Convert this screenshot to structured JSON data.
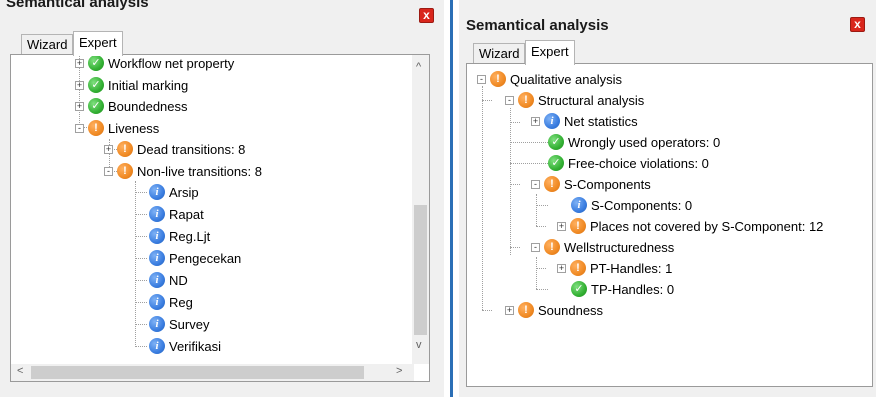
{
  "left": {
    "title": "Semantical analysis",
    "close_glyph": "x",
    "tabs": [
      {
        "label": "Wizard",
        "active": false
      },
      {
        "label": "Expert",
        "active": true
      }
    ],
    "nodes": [
      {
        "label": "Workflow net property",
        "status": "ok",
        "expander": "+"
      },
      {
        "label": "Initial marking",
        "status": "ok",
        "expander": "+"
      },
      {
        "label": "Boundedness",
        "status": "ok",
        "expander": "+"
      },
      {
        "label": "Liveness",
        "status": "warn",
        "expander": "-"
      },
      {
        "label": "Dead transitions: 8",
        "status": "warn",
        "expander": "+"
      },
      {
        "label": "Non-live transitions: 8",
        "status": "warn",
        "expander": "-"
      },
      {
        "label": "Arsip",
        "status": "info"
      },
      {
        "label": "Rapat",
        "status": "info"
      },
      {
        "label": "Reg.Ljt",
        "status": "info"
      },
      {
        "label": "Pengecekan",
        "status": "info"
      },
      {
        "label": "ND",
        "status": "info"
      },
      {
        "label": "Reg",
        "status": "info"
      },
      {
        "label": "Survey",
        "status": "info"
      },
      {
        "label": "Verifikasi",
        "status": "info"
      }
    ],
    "scroll_arrows": {
      "up": "^",
      "down": "v",
      "left": "<",
      "right": ">"
    }
  },
  "right": {
    "title": "Semantical analysis",
    "close_glyph": "x",
    "tabs": [
      {
        "label": "Wizard",
        "active": false
      },
      {
        "label": "Expert",
        "active": true
      }
    ],
    "nodes": [
      {
        "label": "Qualitative analysis",
        "status": "warn",
        "expander": "-"
      },
      {
        "label": "Structural analysis",
        "status": "warn",
        "expander": "-"
      },
      {
        "label": "Net statistics",
        "status": "info",
        "expander": "+"
      },
      {
        "label": "Wrongly used operators: 0",
        "status": "ok"
      },
      {
        "label": "Free-choice violations: 0",
        "status": "ok"
      },
      {
        "label": "S-Components",
        "status": "warn",
        "expander": "-"
      },
      {
        "label": "S-Components: 0",
        "status": "info"
      },
      {
        "label": "Places not covered by S-Component: 12",
        "status": "warn",
        "expander": "+"
      },
      {
        "label": "Wellstructuredness",
        "status": "warn",
        "expander": "-"
      },
      {
        "label": "PT-Handles: 1",
        "status": "warn",
        "expander": "+"
      },
      {
        "label": "TP-Handles: 0",
        "status": "ok"
      },
      {
        "label": "Soundness",
        "status": "warn",
        "expander": "+"
      }
    ]
  },
  "icons": {
    "warn": "!",
    "ok": "✓",
    "info": "i"
  },
  "colors": {
    "warn": "#f08a24",
    "ok": "#33b033",
    "info": "#3a7de0",
    "close": "#d9261c",
    "divider": "#2b6fb6"
  }
}
